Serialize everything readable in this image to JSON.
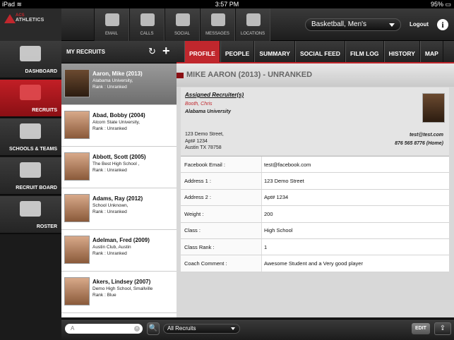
{
  "status": {
    "carrier": "iPad",
    "wifi_icon": "wifi-icon",
    "time": "3:57 PM",
    "battery": "95%"
  },
  "brand": {
    "line1": "ACS",
    "line2": "ATHLETICS"
  },
  "topnav": [
    {
      "label": "EMAIL",
      "icon": "email-icon"
    },
    {
      "label": "CALLS",
      "icon": "phone-icon"
    },
    {
      "label": "SOCIAL",
      "icon": "social-icon"
    },
    {
      "label": "MESSAGES",
      "icon": "messages-icon"
    },
    {
      "label": "LOCATIONS",
      "icon": "globe-icon"
    }
  ],
  "sport": {
    "selected": "Basketball, Men's"
  },
  "header": {
    "logout": "Logout",
    "info": "i"
  },
  "sidebar": [
    {
      "label": "DASHBOARD",
      "icon": "dashboard-icon",
      "active": false
    },
    {
      "label": "RECRUITS",
      "icon": "recruits-icon",
      "active": true
    },
    {
      "label": "SCHOOLS & TEAMS",
      "icon": "schools-icon",
      "active": false
    },
    {
      "label": "RECRUIT BOARD",
      "icon": "board-icon",
      "active": false
    },
    {
      "label": "ROSTER",
      "icon": "roster-icon",
      "active": false
    }
  ],
  "list": {
    "title": "MY RECRUITS",
    "refresh": "↻",
    "add": "+",
    "items": [
      {
        "name": "Aaron, Mike (2013)",
        "school": "Alabama University,",
        "rank": "Rank : Unranked"
      },
      {
        "name": "Abad, Bobby (2004)",
        "school": "Alcorn State University,",
        "rank": "Rank : Unranked"
      },
      {
        "name": "Abbott, Scott (2005)",
        "school": "The Best High School ,",
        "rank": "Rank : Unranked"
      },
      {
        "name": "Adams, Ray (2012)",
        "school": "School Unknown,",
        "rank": "Rank : Unranked"
      },
      {
        "name": "Adelman, Fred (2009)",
        "school": "Austin Club, Austin",
        "rank": "Rank : Unranked"
      },
      {
        "name": "Akers, Lindsey (2007)",
        "school": "Demo High School, Smallville",
        "rank": "Rank : Blue"
      }
    ]
  },
  "tabs": [
    "PROFILE",
    "PEOPLE",
    "SUMMARY",
    "SOCIAL FEED",
    "FILM LOG",
    "HISTORY",
    "MAP"
  ],
  "detail": {
    "title": "MIKE AARON (2013) - UNRANKED",
    "card": {
      "heading": "Assigned Recruiter(s)",
      "recruiter": "Booth, Chris",
      "school": "Alabama University",
      "addr1": "123 Demo Street,",
      "addr2": "Apt# 1234",
      "addr3": "Austin TX 78758",
      "email": "test@test.com",
      "phone": "876 565 8776 (Home)"
    },
    "rows": [
      {
        "k": "Facebook Email :",
        "v": "test@facebook.com"
      },
      {
        "k": "Address 1 :",
        "v": "123 Demo Street"
      },
      {
        "k": "Address 2 :",
        "v": "Apt# 1234"
      },
      {
        "k": "Weight :",
        "v": "200"
      },
      {
        "k": "Class :",
        "v": "High School"
      },
      {
        "k": "Class Rank :",
        "v": "1"
      },
      {
        "k": "Coach Comment :",
        "v": "Awesome Student and a Very good player"
      }
    ]
  },
  "bottom": {
    "search_value": "A",
    "clear": "×",
    "search_btn": "🔍",
    "filter": "All Recruits",
    "edit": "EDIT",
    "share": "⇪"
  }
}
